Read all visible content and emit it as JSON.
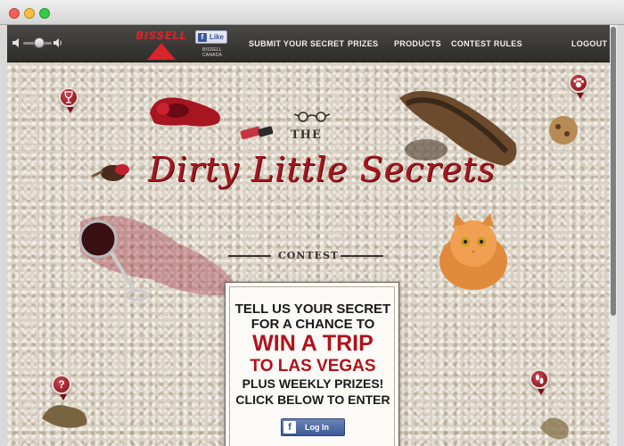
{
  "window": {
    "controls": [
      "close",
      "minimize",
      "zoom"
    ]
  },
  "nav": {
    "volume": {
      "low_icon": "speaker-low-icon",
      "high_icon": "speaker-high-icon",
      "level": 0.45
    },
    "logo_text": "BISSELL",
    "like": {
      "label": "Like",
      "caption": "BISSELL CANADA"
    },
    "links": [
      "SUBMIT YOUR SECRET",
      "PRIZES",
      "PRODUCTS",
      "CONTEST RULES"
    ],
    "logout": "LOGOUT"
  },
  "title": {
    "the": "THE",
    "main": "Dirty Little Secrets",
    "contest": "CONTEST"
  },
  "card": {
    "lines": [
      "TELL US YOUR SECRET",
      "FOR A CHANCE TO",
      "WIN A TRIP",
      "TO LAS VEGAS",
      "PLUS WEEKLY PRIZES!",
      "CLICK BELOW TO ENTER"
    ],
    "login_label": "Log In"
  },
  "pins": {
    "wine": "wine-glass-icon",
    "paw": "paw-icon",
    "question": "question-mark-icon",
    "footprints": "footprints-icon"
  },
  "colors": {
    "brand_red": "#d9252b",
    "title_red": "#a3161f",
    "facebook": "#3b5998"
  }
}
